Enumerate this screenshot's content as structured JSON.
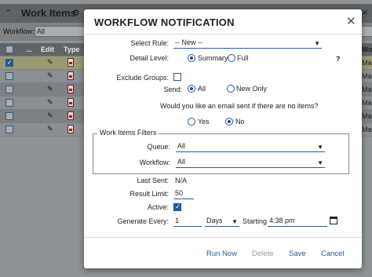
{
  "background": {
    "title": "Work Items",
    "workflow_label": "Workflow:",
    "workflow_value": "All",
    "columns": [
      "Edit",
      "Type"
    ],
    "ellipsis": "...",
    "right_col_header_top": "Q",
    "right_col_header": "Wo",
    "right_col_header2": "ueu",
    "right_cells": [
      "Ma",
      "Ma",
      "Ma",
      "Ma",
      "Ma",
      "Ma"
    ]
  },
  "modal": {
    "title": "WORKFLOW NOTIFICATION",
    "select_rule_label": "Select Rule:",
    "select_rule_value": "-- New --",
    "detail_level_label": "Detail Level:",
    "detail_summary": "Summary",
    "detail_full": "Full",
    "help": "?",
    "exclude_groups_label": "Exclude Groups:",
    "send_label": "Send:",
    "send_all": "All",
    "send_new_only": "New Only",
    "empty_question": "Would you like an email sent if there are no items?",
    "yes": "Yes",
    "no": "No",
    "filters_legend": "Work Items Filters",
    "queue_label": "Queue:",
    "queue_value": "All",
    "workflow_label": "Workflow:",
    "workflow_value": "All",
    "last_sent_label": "Last Sent:",
    "last_sent_value": "N/A",
    "result_limit_label": "Result Limit:",
    "result_limit_value": "50",
    "active_label": "Active:",
    "generate_every_label": "Generate Every:",
    "generate_every_value": "1",
    "generate_unit": "Days",
    "starting_label": "Starting",
    "starting_value": "4:38 pm",
    "buttons": {
      "run_now": "Run Now",
      "delete": "Delete",
      "save": "Save",
      "cancel": "Cancel"
    }
  },
  "state": {
    "detail_level": "Summary",
    "send": "All",
    "send_empty": "No",
    "exclude_groups": false,
    "active": true
  },
  "colors": {
    "accent": "#1f5a9c",
    "overlay_bg": "#8e9397"
  }
}
